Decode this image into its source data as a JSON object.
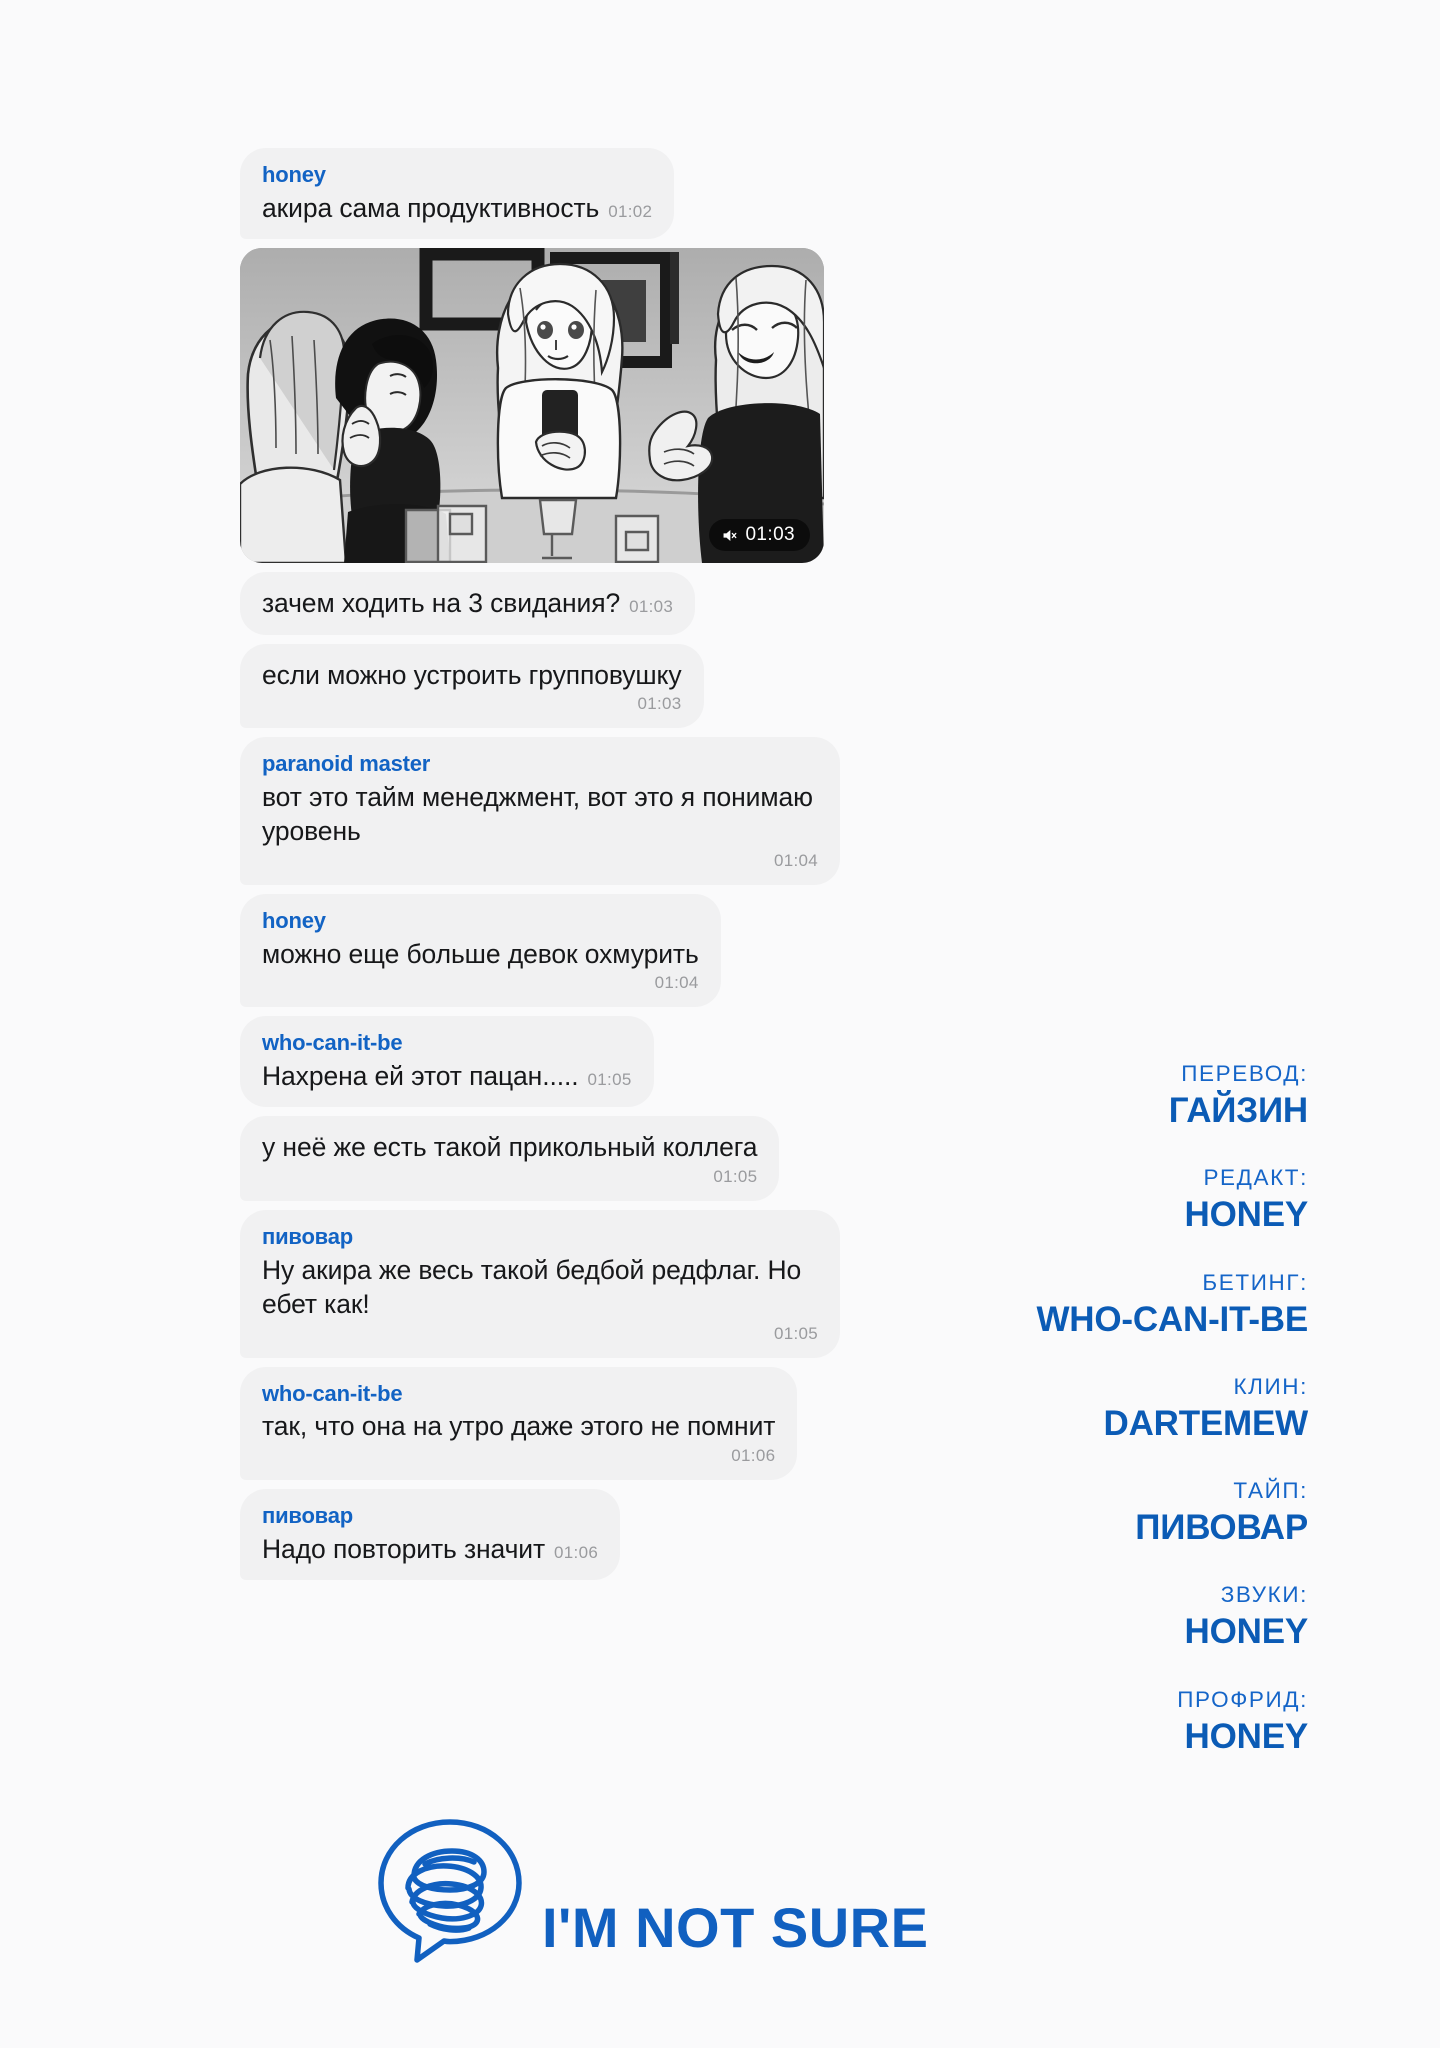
{
  "page": {
    "background_color": "#fafafb",
    "accent_color": "#0b5bb5",
    "bubble_color": "#f1f1f2",
    "text_color": "#17181a",
    "time_color": "#9a9b9e"
  },
  "chat": {
    "messages": [
      {
        "type": "text",
        "sender": "honey",
        "text": "акира сама продуктивность",
        "time": "01:02",
        "time_inline": true,
        "show_sender": true
      },
      {
        "type": "media",
        "caption": "manga panel: four women at a bar counter, one holding a phone",
        "badge_time": "01:03",
        "badge_icon": "muted-speaker-icon",
        "show_sender": false
      },
      {
        "type": "text",
        "sender": "honey",
        "text": "зачем ходить на 3 свидания?",
        "time": "01:03",
        "time_inline": true,
        "show_sender": false
      },
      {
        "type": "text",
        "sender": "honey",
        "text": "если можно устроить групповушку",
        "time": "01:03",
        "time_inline": false,
        "show_sender": false
      },
      {
        "type": "text",
        "sender": "paranoid master",
        "text": "вот это тайм менеджмент, вот это я понимаю уровень",
        "time": "01:04",
        "time_inline": false,
        "show_sender": true
      },
      {
        "type": "text",
        "sender": "honey",
        "text": "можно еще больше девок охмурить",
        "time": "01:04",
        "time_inline": false,
        "show_sender": true
      },
      {
        "type": "text",
        "sender": "who-can-it-be",
        "text": "Нахрена ей этот пацан.....",
        "time": "01:05",
        "time_inline": true,
        "show_sender": true
      },
      {
        "type": "text",
        "sender": "who-can-it-be",
        "text": "у неё же есть такой прикольный коллега",
        "time": "01:05",
        "time_inline": false,
        "show_sender": false
      },
      {
        "type": "text",
        "sender": "пивовар",
        "text": "Ну акира же весь такой бедбой редфлаг. Но ебет как!",
        "time": "01:05",
        "time_inline": false,
        "show_sender": true
      },
      {
        "type": "text",
        "sender": "who-can-it-be",
        "text": "так, что она на утро даже этого не помнит",
        "time": "01:06",
        "time_inline": false,
        "show_sender": true
      },
      {
        "type": "text",
        "sender": "пивовар",
        "text": "Надо повторить значит",
        "time": "01:06",
        "time_inline": true,
        "show_sender": true
      }
    ]
  },
  "credits": [
    {
      "role": "ПЕРЕВОД:",
      "name": "ГАЙЗИН"
    },
    {
      "role": "РЕДАКТ:",
      "name": "HONEY"
    },
    {
      "role": "БЕТИНГ:",
      "name": "WHO-CAN-IT-BE"
    },
    {
      "role": "КЛИН:",
      "name": "DARTEMEW"
    },
    {
      "role": "ТАЙП:",
      "name": "ПИВОВАР"
    },
    {
      "role": "ЗВУКИ:",
      "name": "HONEY"
    },
    {
      "role": "ПРОФРИД:",
      "name": "HONEY"
    }
  ],
  "footer": {
    "logo_icon": "speech-bubble-scribble-icon",
    "logo_text": "I'M NOT SURE"
  }
}
